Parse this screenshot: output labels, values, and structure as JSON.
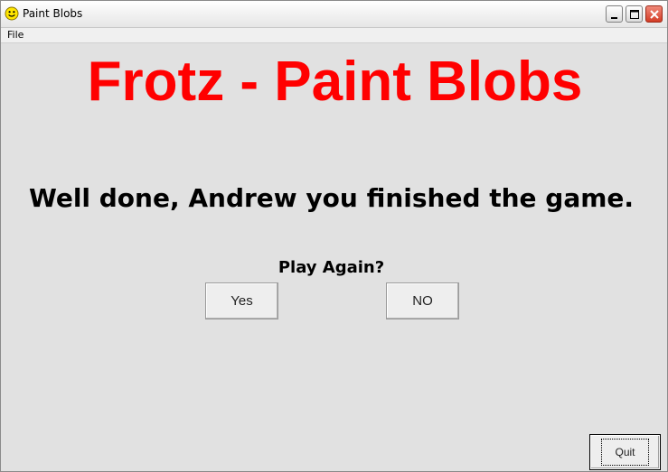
{
  "window": {
    "title": "Paint Blobs"
  },
  "menu": {
    "file_label": "File"
  },
  "game": {
    "heading": "Frotz - Paint Blobs",
    "message": "Well done, Andrew you finished the game.",
    "prompt": "Play Again?",
    "yes_label": "Yes",
    "no_label": "NO",
    "quit_label": "Quit"
  },
  "colors": {
    "heading": "#ff0000",
    "background": "#e1e1e1",
    "text": "#000000"
  },
  "icons": {
    "app": "smiley-face-icon",
    "minimize": "minimize-icon",
    "maximize": "maximize-icon",
    "close": "close-icon"
  }
}
